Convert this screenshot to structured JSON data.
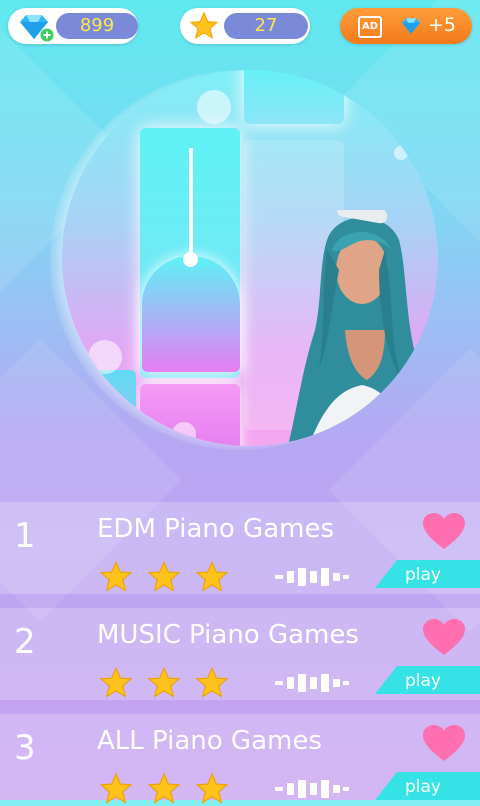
{
  "top_bar": {
    "gems": "899",
    "stars": "27",
    "ad_reward": "+5",
    "ad_badge": "AD"
  },
  "songs": [
    {
      "number": "1",
      "title": "EDM Piano Games",
      "stars": 3,
      "play_label": "play"
    },
    {
      "number": "2",
      "title": "MUSIC Piano Games",
      "stars": 3,
      "play_label": "play"
    },
    {
      "number": "3",
      "title": "ALL Piano Games",
      "stars": 3,
      "play_label": "play"
    }
  ],
  "colors": {
    "gold": "#ffc21a",
    "heart": "#ff6fb1",
    "play": "#35e2e6",
    "pill_value": "#7a8ad8"
  }
}
